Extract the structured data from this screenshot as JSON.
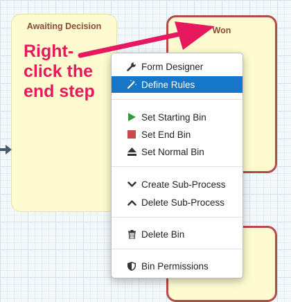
{
  "bins": {
    "awaiting": {
      "title": "Awaiting Decision"
    },
    "won": {
      "title": "Won"
    }
  },
  "callout": {
    "text": "Right-\nclick the\nend step",
    "color": "#e8185e"
  },
  "colors": {
    "bin_fill": "#fdfbcf",
    "end_bin_border": "#b54a4a",
    "menu_highlight": "#1677c9",
    "start_icon": "#2e9e3a",
    "end_icon": "#c94a4a"
  },
  "context_menu": {
    "items": [
      {
        "label": "Form Designer",
        "icon": "wrench-icon"
      },
      {
        "label": "Define Rules",
        "icon": "magic-wand-icon",
        "highlighted": true
      },
      {
        "label": "Set Starting Bin",
        "icon": "play-triangle-icon"
      },
      {
        "label": "Set End Bin",
        "icon": "red-square-icon"
      },
      {
        "label": "Set Normal Bin",
        "icon": "eject-icon"
      },
      {
        "label": "Create Sub-Process",
        "icon": "chevron-down-icon"
      },
      {
        "label": "Delete Sub-Process",
        "icon": "chevron-up-icon"
      },
      {
        "label": "Delete Bin",
        "icon": "trash-icon"
      },
      {
        "label": "Bin Permissions",
        "icon": "shield-icon"
      }
    ]
  }
}
